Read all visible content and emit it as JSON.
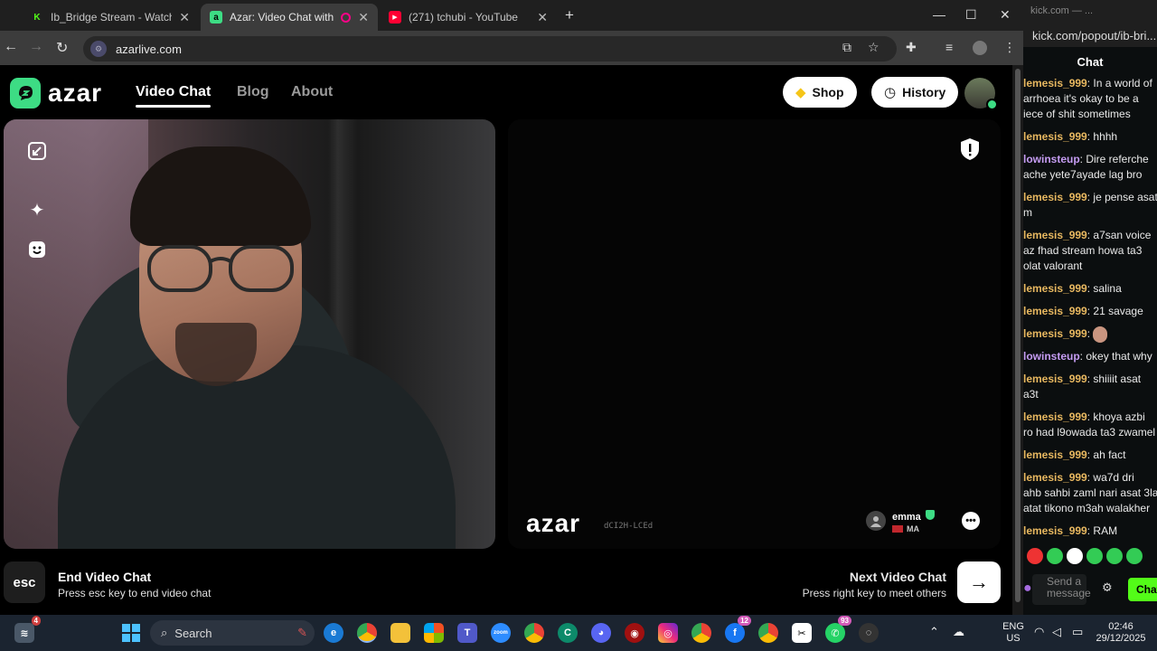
{
  "browser": {
    "tabs": [
      {
        "title": "Ib_Bridge Stream - Watch Live",
        "favicon": "K",
        "favicon_color": "#53fc18"
      },
      {
        "title": "Azar: Video Chat with New",
        "favicon": "a",
        "favicon_color": "#3ddc84"
      },
      {
        "title": "(271) tchubi - YouTube",
        "favicon": "▶",
        "favicon_color": "#ff0033"
      }
    ],
    "new_tab": "+",
    "url": "azarlive.com"
  },
  "azar": {
    "brand": "azar",
    "nav": [
      {
        "label": "Video Chat"
      },
      {
        "label": "Blog"
      },
      {
        "label": "About"
      }
    ],
    "shop_label": "Shop",
    "history_label": "History",
    "remote": {
      "logo": "azar",
      "code": "dCI2H-LCEd",
      "peer_name": "emma",
      "peer_country": "MA"
    },
    "end": {
      "key": "esc",
      "title": "End Video Chat",
      "subtitle": "Press esc key to end video chat"
    },
    "next": {
      "title": "Next Video Chat",
      "subtitle": "Press right key to meet others"
    },
    "accent": "#3ddc84"
  },
  "kick": {
    "window_title": "kick.com — ...",
    "url": "kick.com/popout/ib-bri...",
    "header": "Chat",
    "messages": [
      {
        "user": "lemesis_999",
        "lines": [
          "In a world of",
          "arrhoea it's okay to be a",
          "iece of shit sometimes"
        ]
      },
      {
        "user": "lemesis_999",
        "lines": [
          "hhhh"
        ]
      },
      {
        "user": "lowinsteup",
        "lines": [
          "Dire referche",
          "ache yete7ayade lag bro"
        ]
      },
      {
        "user": "lemesis_999",
        "lines": [
          "je pense asat",
          "m"
        ]
      },
      {
        "user": "lemesis_999",
        "lines": [
          "a7san voice",
          "az fhad stream howa ta3",
          "olat valorant"
        ]
      },
      {
        "user": "lemesis_999",
        "lines": [
          "salina"
        ]
      },
      {
        "user": "lemesis_999",
        "lines": [
          "21 savage"
        ]
      },
      {
        "user": "lemesis_999",
        "lines": [
          ""
        ]
      },
      {
        "user": "lowinsteup",
        "lines": [
          "okey that why"
        ]
      },
      {
        "user": "lemesis_999",
        "lines": [
          "shiiiit asat",
          "a3t"
        ]
      },
      {
        "user": "lemesis_999",
        "lines": [
          "khoya azbi",
          "ro had l9owada ta3 zwamel"
        ]
      },
      {
        "user": "lemesis_999",
        "lines": [
          "ah fact"
        ]
      },
      {
        "user": "lemesis_999",
        "lines": [
          "wa7d dri",
          "ahb sahbi zaml nari asat 3la",
          "atat tikono m3ah walakher"
        ]
      },
      {
        "user": "lemesis_999",
        "lines": [
          "RAM"
        ]
      }
    ],
    "input_placeholder": "Send a message",
    "send_label": "Chat"
  },
  "taskbar": {
    "search_label": "Search",
    "lang_1": "ENG",
    "lang_2": "US",
    "time": "02:46",
    "date": "29/12/2025",
    "badge_discord": "4",
    "badge_facebook": "12",
    "badge_whatsapp": "93"
  }
}
